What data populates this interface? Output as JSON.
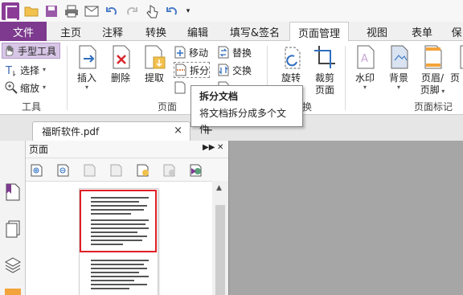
{
  "quick_access": {
    "items": [
      "app-logo",
      "open-icon",
      "save-icon",
      "print-icon",
      "email-icon",
      "undo-icon",
      "redo-icon",
      "pointer-icon",
      "undo-history-icon",
      "customize-icon"
    ]
  },
  "menu": {
    "file": "文件",
    "tabs": [
      "主页",
      "注释",
      "转换",
      "编辑",
      "填写&签名",
      "页面管理",
      "视图",
      "表单",
      "保"
    ],
    "active": "页面管理"
  },
  "ribbon": {
    "tools": {
      "hand": "手型工具",
      "select": "选择",
      "zoom": "缩放",
      "group_label": "工具"
    },
    "pages": {
      "insert": "插入",
      "delete": "删除",
      "extract": "提取",
      "move": "移动",
      "split": "拆分",
      "replace": "替换",
      "swap": "交换",
      "group_label": "页面"
    },
    "transform": {
      "rotate": "旋转",
      "crop_line1": "裁剪",
      "crop_line2": "页面",
      "group_label_partial": "换"
    },
    "marks": {
      "watermark": "水印",
      "background": "背景",
      "header_line1": "页眉/",
      "header_line2": "页脚",
      "page_partial": "页",
      "group_label": "页面标记"
    }
  },
  "tooltip": {
    "title": "拆分文档",
    "description": "将文档拆分成多个文件"
  },
  "document_tab": {
    "name": "福昕软件.pdf",
    "close": "×",
    "new_tab": "+"
  },
  "panel": {
    "title": "页面",
    "expand": "▶▶",
    "close": "✕"
  },
  "colors": {
    "brand": "#7d3a8e",
    "selection": "#e01f26",
    "canvas": "#a6a6a6"
  }
}
